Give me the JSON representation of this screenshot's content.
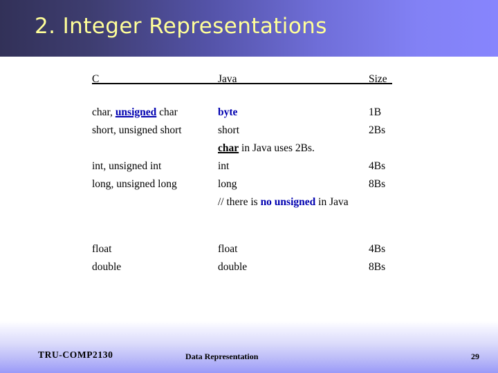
{
  "slide": {
    "title": "2. Integer Representations",
    "title_color": "#ffff99",
    "banner_gradient_from": "#323158",
    "banner_gradient_to": "#8785fd",
    "accent_blue": "#0000b0"
  },
  "table": {
    "headers": {
      "c": "C",
      "java": "Java",
      "size": "Size"
    },
    "rows": [
      {
        "c_plain_1": "char, ",
        "c_blue_underline": "unsigned",
        "c_plain_2": " char",
        "java_blue_bold": "byte",
        "size": "1B"
      },
      {
        "c": "short, unsigned short",
        "java": "short",
        "size": "2Bs"
      },
      {
        "java_black_underline": "char",
        "java_plain": " in Java uses 2Bs."
      },
      {
        "c": "int, unsigned int",
        "java": "int",
        "size": "4Bs"
      },
      {
        "c": "long, unsigned long",
        "java": "long",
        "size": "8Bs"
      },
      {
        "java_plain_1": "// there is ",
        "java_blue_bold": "no unsigned",
        "java_plain_2": " in Java"
      },
      {
        "c": "float",
        "java": "float",
        "size": "4Bs"
      },
      {
        "c": "double",
        "java": "double",
        "size": "8Bs"
      }
    ]
  },
  "footer": {
    "course": "TRU-COMP2130",
    "topic": "Data Representation",
    "page_number": "29"
  }
}
